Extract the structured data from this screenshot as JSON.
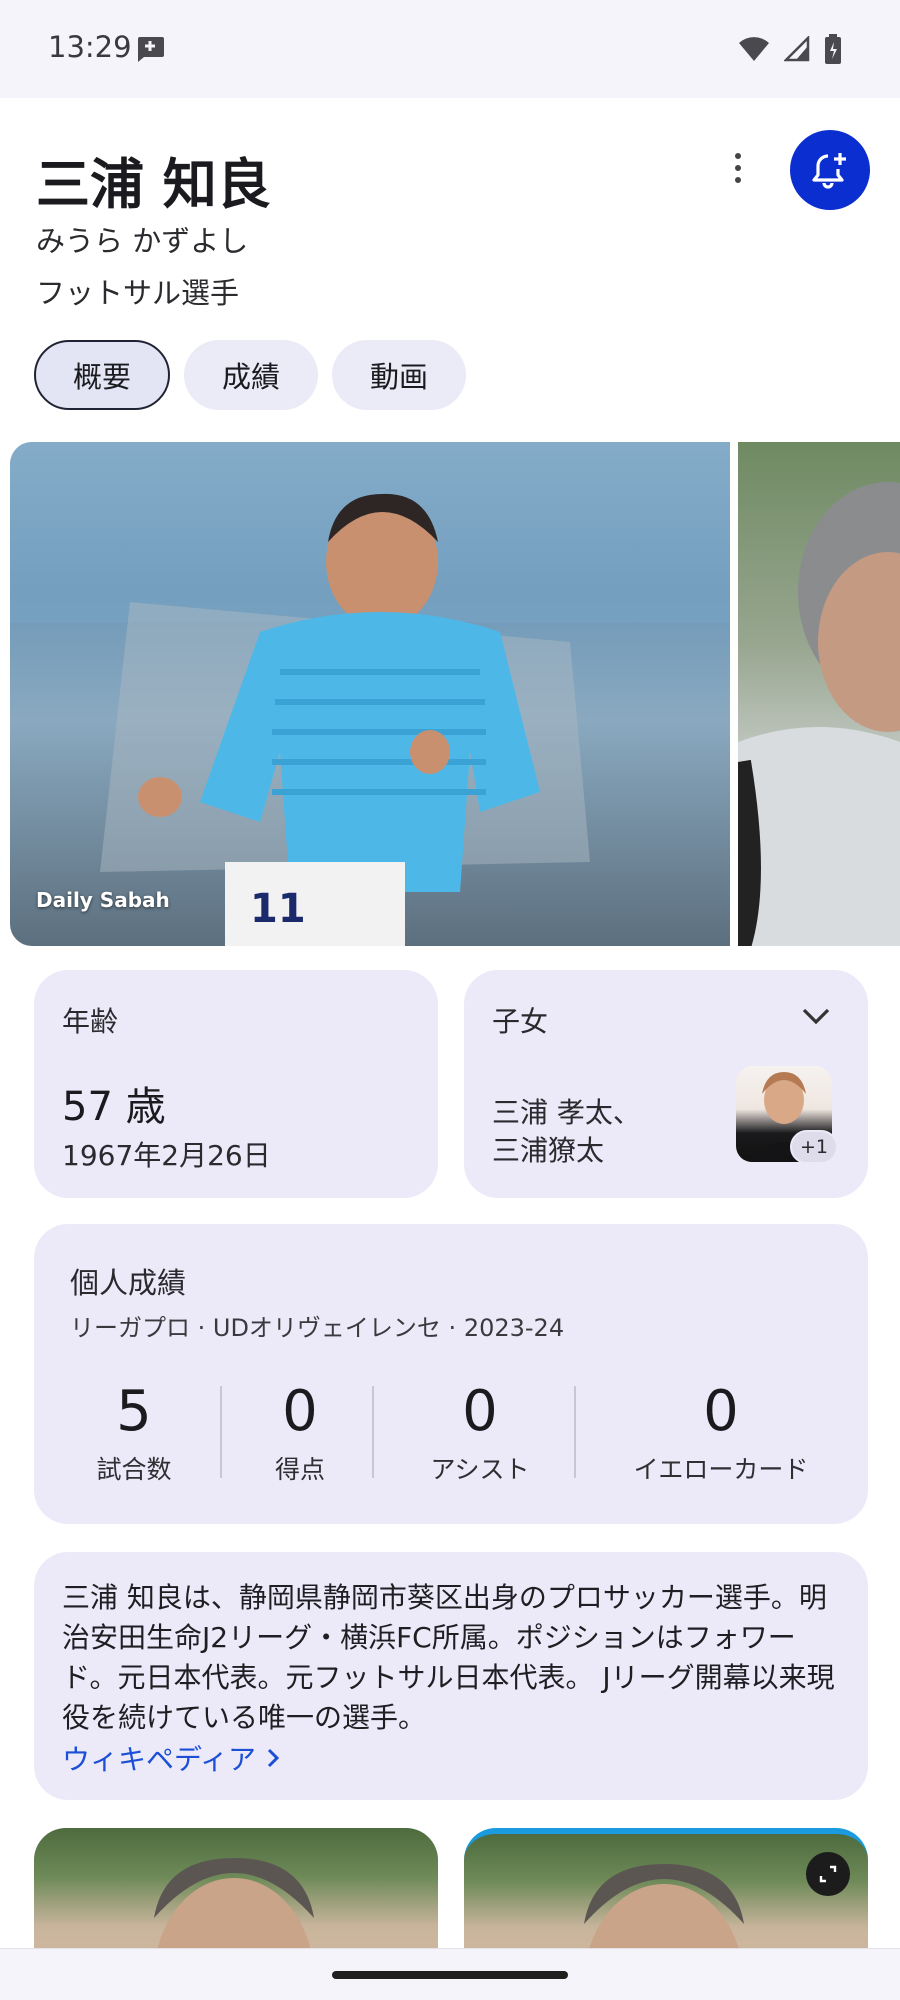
{
  "status_bar": {
    "time": "13:29"
  },
  "header": {
    "title": "三浦 知良",
    "reading": "みうら かずよし",
    "subtitle": "フットサル選手"
  },
  "tabs": [
    {
      "label": "概要",
      "active": true
    },
    {
      "label": "成績",
      "active": false
    },
    {
      "label": "動画",
      "active": false
    }
  ],
  "gallery": {
    "credit": "Daily Sabah"
  },
  "age": {
    "label": "年齢",
    "value": "57 歳",
    "birthdate": "1967年2月26日"
  },
  "children": {
    "label": "子女",
    "names_line1": "三浦 孝太、",
    "names_line2": "三浦獠太",
    "more_count": "+1"
  },
  "stats": {
    "title": "個人成績",
    "subtitle": "リーガプロ · UDオリヴェイレンセ · 2023-24",
    "items": [
      {
        "value": "5",
        "label": "試合数"
      },
      {
        "value": "0",
        "label": "得点"
      },
      {
        "value": "0",
        "label": "アシスト"
      },
      {
        "value": "0",
        "label": "イエローカード"
      }
    ]
  },
  "about": {
    "text": "三浦 知良は、静岡県静岡市葵区出身のプロサッカー選手。明治安田生命J2リーグ・横浜FC所属。ポジションはフォワード。元日本代表。元フットサル日本代表。 Jリーグ開幕以来現役を続けている唯一の選手。",
    "link": "ウィキペディア"
  },
  "colors": {
    "accent": "#0b2ed1",
    "card": "#eceaf9",
    "link": "#1a4fd6"
  }
}
